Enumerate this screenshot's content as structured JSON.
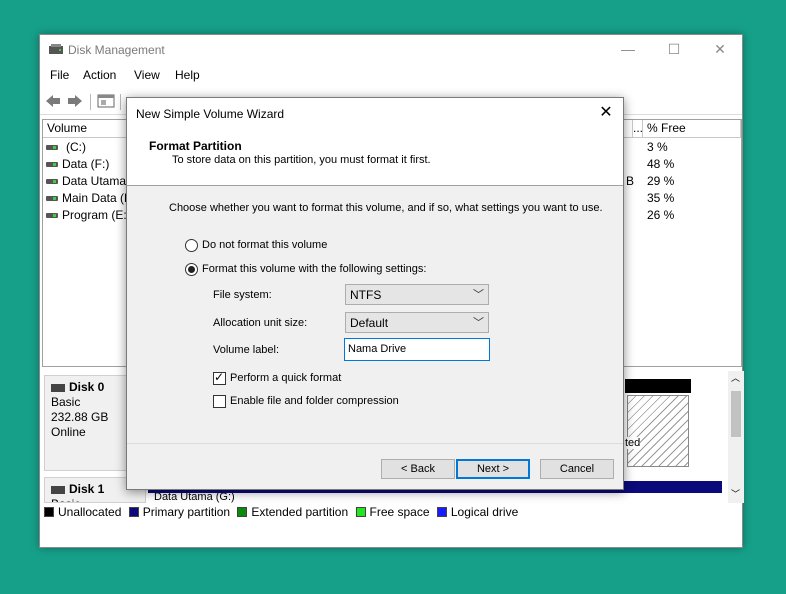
{
  "window": {
    "title": "Disk Management",
    "minimize": "—",
    "maximize": "☐",
    "close": "✕"
  },
  "menu": [
    "File",
    "Action",
    "View",
    "Help"
  ],
  "volume_list": {
    "columns": {
      "volume": "Volume",
      "ellipsis": "...",
      "pct_free": "% Free"
    },
    "rows": [
      {
        "name": "(C:)",
        "free": "3 %"
      },
      {
        "name": "Data (F:)",
        "free": "48 %"
      },
      {
        "name": "Data Utama",
        "free": "29 %",
        "extra": "B"
      },
      {
        "name": "Main Data (D",
        "free": "35 %"
      },
      {
        "name": "Program (E:)",
        "free": "26 %"
      }
    ]
  },
  "disks": [
    {
      "name": "Disk 0",
      "type": "Basic",
      "size": "232.88 GB",
      "status": "Online",
      "partial_text": "ted"
    },
    {
      "name": "Disk 1",
      "type": "Basic",
      "partial_vol": "Data Utama (G:)"
    }
  ],
  "legend": [
    {
      "label": "Unallocated",
      "color": "#000000"
    },
    {
      "label": "Primary partition",
      "color": "#0a0a7a"
    },
    {
      "label": "Extended partition",
      "color": "#0a8a0a"
    },
    {
      "label": "Free space",
      "color": "#22e622"
    },
    {
      "label": "Logical drive",
      "color": "#1a1aff"
    }
  ],
  "dialog": {
    "title": "New Simple Volume Wizard",
    "close": "✕",
    "header_title": "Format Partition",
    "header_subtitle": "To store data on this partition, you must format it first.",
    "description": "Choose whether you want to format this volume, and if so, what settings you want to use.",
    "option_no_format": "Do not format this volume",
    "option_format": "Format this volume with the following settings:",
    "file_system_label": "File system:",
    "file_system_value": "NTFS",
    "alloc_label": "Allocation unit size:",
    "alloc_value": "Default",
    "volume_label_label": "Volume label:",
    "volume_label_value": "Nama Drive",
    "quick_format": "Perform a quick format",
    "compression": "Enable file and folder compression",
    "back": "< Back",
    "next": "Next >",
    "cancel": "Cancel"
  }
}
